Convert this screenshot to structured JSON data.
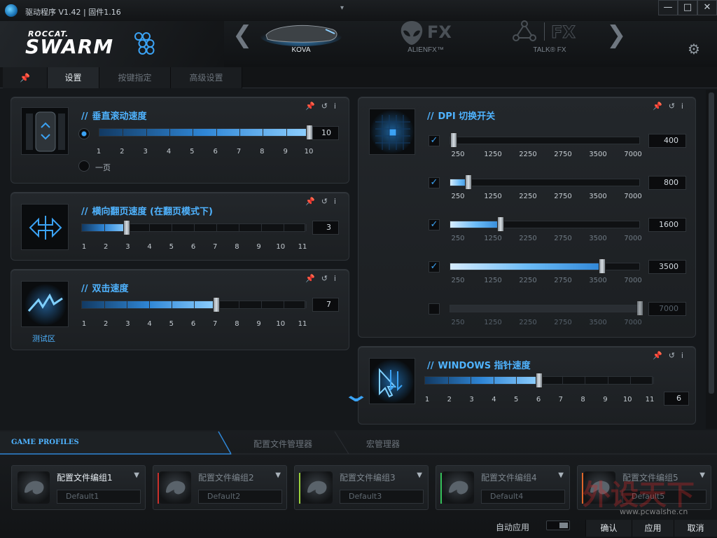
{
  "window": {
    "title": "驱动程序 V1.42 | 固件1.16",
    "minimize": "—",
    "maximize": "□",
    "close": "✕"
  },
  "logo": {
    "brand_top": "ROCCAT.",
    "brand_main": "SWARM"
  },
  "devices": [
    {
      "label": "KOVA",
      "active": true
    },
    {
      "label": "ALIENFX™",
      "active": false
    },
    {
      "label": "TALK® FX",
      "active": false
    }
  ],
  "nav": {
    "prev": "❮",
    "next": "❯",
    "dropdown": "▾"
  },
  "header_logos": {
    "alien_fx": "FX",
    "talk_fx": "FX"
  },
  "settings_icon": "⚙",
  "tabs": [
    {
      "label": "设置",
      "active": true
    },
    {
      "label": "按键指定",
      "active": false
    },
    {
      "label": "高级设置",
      "active": false
    }
  ],
  "pin_icon": "📌",
  "panel_icons": {
    "pin": "📌",
    "reset": "↺",
    "info": "i"
  },
  "vertical_scroll": {
    "title": "垂直滚动速度",
    "value": "10",
    "level": 10,
    "max": 10,
    "ticks": [
      "1",
      "2",
      "3",
      "4",
      "5",
      "6",
      "7",
      "8",
      "9",
      "10"
    ],
    "option_page": "一页"
  },
  "horizontal_scroll": {
    "title": "横向翻页速度 (在翻页模式下)",
    "value": "3",
    "level": 3,
    "max": 11,
    "ticks": [
      "1",
      "2",
      "3",
      "4",
      "5",
      "6",
      "7",
      "8",
      "9",
      "10",
      "11"
    ]
  },
  "double_click": {
    "title": "双击速度",
    "value": "7",
    "level": 7,
    "max": 11,
    "ticks": [
      "1",
      "2",
      "3",
      "4",
      "5",
      "6",
      "7",
      "8",
      "9",
      "10",
      "11"
    ],
    "test_area": "测试区"
  },
  "dpi": {
    "title": "DPI 切换开关",
    "tick_labels": [
      "250",
      "1250",
      "2250",
      "2750",
      "3500",
      "7000"
    ],
    "rows": [
      {
        "checked": true,
        "value": "400",
        "fraction": 0.0
      },
      {
        "checked": true,
        "value": "800",
        "fraction": 0.1
      },
      {
        "checked": true,
        "value": "1600",
        "fraction": 0.27
      },
      {
        "checked": true,
        "value": "3500",
        "fraction": 0.8
      },
      {
        "checked": false,
        "value": "7000",
        "fraction": 1.0
      }
    ]
  },
  "windows_pointer": {
    "title": "WINDOWS 指针速度",
    "value": "6",
    "level": 6,
    "max": 11,
    "ticks": [
      "1",
      "2",
      "3",
      "4",
      "5",
      "6",
      "7",
      "8",
      "9",
      "10",
      "11"
    ]
  },
  "scroll_down_icon": "⌄",
  "bottom_tabs": {
    "game_profiles": "GAME PROFILES",
    "profile_manager": "配置文件管理器",
    "macro_manager": "宏管理器"
  },
  "profiles": [
    {
      "name": "配置文件编组1",
      "default": "Default1",
      "active": true,
      "accent": ""
    },
    {
      "name": "配置文件编组2",
      "default": "Default2",
      "active": false,
      "accent": "#c9302c"
    },
    {
      "name": "配置文件编组3",
      "default": "Default3",
      "active": false,
      "accent": "#9bd23c"
    },
    {
      "name": "配置文件编组4",
      "default": "Default4",
      "active": false,
      "accent": "#35c05a"
    },
    {
      "name": "配置文件编组5",
      "default": "Default5",
      "active": false,
      "accent": "#e0662a"
    }
  ],
  "profile_caret": "▼",
  "footer": {
    "auto_apply": "自动应用",
    "ok": "确认",
    "apply": "应用",
    "cancel": "取消"
  },
  "watermark": {
    "text": "www.pcwaishe.cn"
  },
  "colors": {
    "accent": "#4fb3ff",
    "background": "#15181b"
  }
}
